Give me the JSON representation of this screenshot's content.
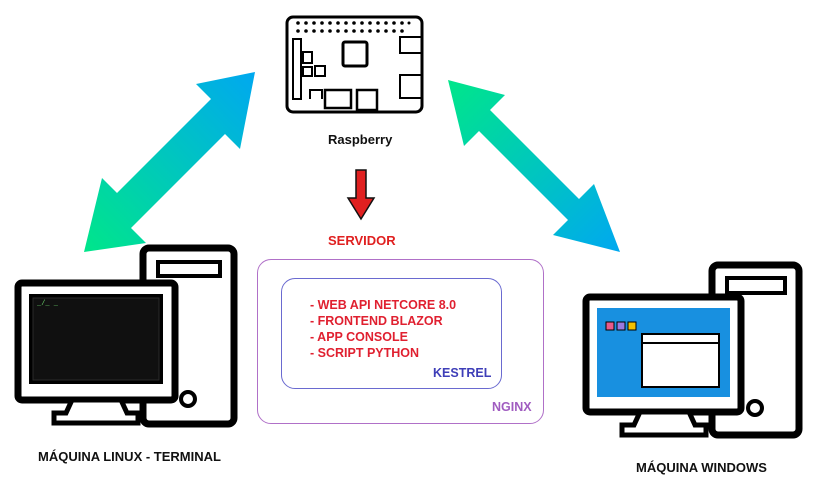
{
  "nodes": {
    "raspberry": "Raspberry",
    "linux": "MÁQUINA LINUX - TERMINAL",
    "windows": "MÁQUINA WINDOWS"
  },
  "server": {
    "title": "SERVIDOR",
    "services": [
      "- WEB API NETCORE 8.0",
      "- FRONTEND BLAZOR",
      "- APP CONSOLE",
      "- SCRIPT PYTHON"
    ],
    "inner_box": "KESTREL",
    "outer_box": "NGINX"
  },
  "terminal_prompt": "_/_ _",
  "colors": {
    "arrow_gradient_start": "#00e68a",
    "arrow_gradient_end": "#00a8f0",
    "down_arrow": "#e02020",
    "nginx_border": "#b070c8",
    "kestrel_border": "#6a6ad0",
    "service_text": "#e02030",
    "windows_screen": "#1890e0"
  }
}
